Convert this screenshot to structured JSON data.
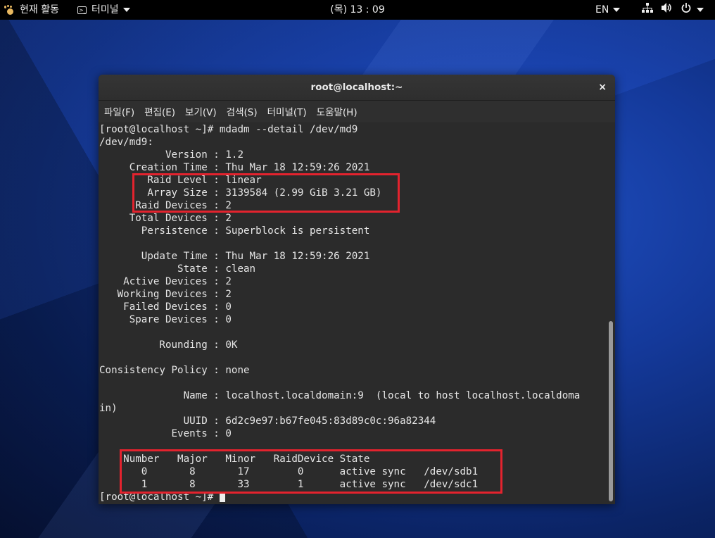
{
  "topbar": {
    "activities": "현재 활동",
    "app_menu": "터미널",
    "clock": "(목) 13 : 09",
    "language": "EN",
    "icons": [
      "network-icon",
      "volume-icon",
      "power-icon"
    ]
  },
  "window": {
    "title": "root@localhost:~",
    "close": "×",
    "menu": [
      "파일(F)",
      "편집(E)",
      "보기(V)",
      "검색(S)",
      "터미널(T)",
      "도움말(H)"
    ]
  },
  "terminal": {
    "lines": [
      "[root@localhost ~]# mdadm --detail /dev/md9",
      "/dev/md9:",
      "           Version : 1.2",
      "     Creation Time : Thu Mar 18 12:59:26 2021",
      "        Raid Level : linear",
      "        Array Size : 3139584 (2.99 GiB 3.21 GB)",
      "      Raid Devices : 2",
      "     Total Devices : 2",
      "       Persistence : Superblock is persistent",
      "",
      "       Update Time : Thu Mar 18 12:59:26 2021",
      "             State : clean",
      "    Active Devices : 2",
      "   Working Devices : 2",
      "    Failed Devices : 0",
      "     Spare Devices : 0",
      "",
      "          Rounding : 0K",
      "",
      "Consistency Policy : none",
      "",
      "              Name : localhost.localdomain:9  (local to host localhost.localdoma",
      "in)",
      "              UUID : 6d2c9e97:b67fe045:83d89c0c:96a82344",
      "            Events : 0",
      "",
      "    Number   Major   Minor   RaidDevice State",
      "       0       8       17        0      active sync   /dev/sdb1",
      "       1       8       33        1      active sync   /dev/sdc1"
    ],
    "prompt": "[root@localhost ~]# "
  },
  "colors": {
    "highlight": "#e3232e",
    "terminal_bg": "#2b2b2b"
  }
}
